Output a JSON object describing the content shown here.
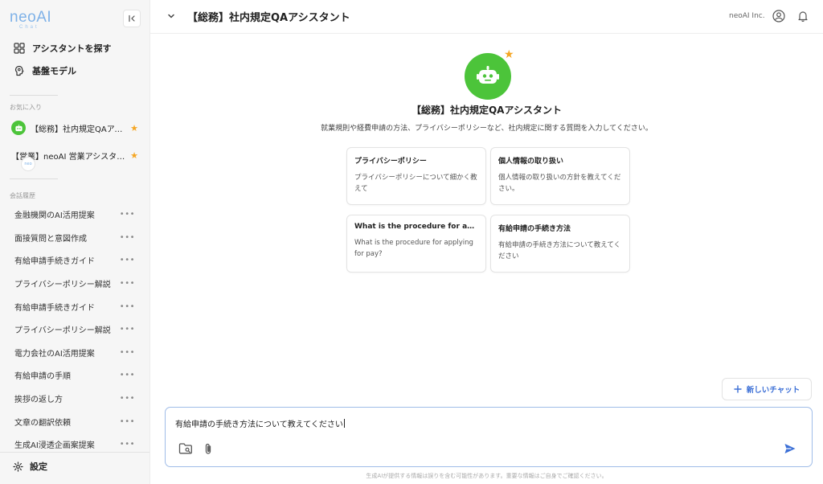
{
  "logo": {
    "main": "neoAI",
    "sub": "Chat"
  },
  "nav": {
    "find_assistant": "アシスタントを探す",
    "base_models": "基盤モデル"
  },
  "favorites": {
    "label": "お気に入り",
    "items": [
      {
        "label": "【総務】社内規定QAアシスタント",
        "avatar": "robot-icon"
      },
      {
        "label": "【営業】neoAI 営業アシスタント",
        "avatar": "neoai-logo-icon"
      }
    ]
  },
  "history": {
    "label": "会話履歴",
    "items": [
      "金融機関のAI活用提案",
      "面接質問と意図作成",
      "有給申請手続きガイド",
      "プライバシーポリシー解説",
      "有給申請手続きガイド",
      "プライバシーポリシー解説",
      "電力会社のAI活用提案",
      "有給申請の手順",
      "挨拶の返し方",
      "文章の翻訳依頼",
      "生成AI浸透企画案提案"
    ],
    "more": "•••"
  },
  "settings_label": "設定",
  "header": {
    "title": "【総務】社内規定QAアシスタント",
    "org": "neoAI Inc."
  },
  "assistant": {
    "title": "【総務】社内規定QAアシスタント",
    "description": "就業規則や経費申請の方法、プライバシーポリシーなど、社内規定に関する質問を入力してください。"
  },
  "suggestions": [
    {
      "title": "プライバシーポリシー",
      "body": "プライバシーポリシーについて細かく教えて"
    },
    {
      "title": "個人情報の取り扱い",
      "body": "個人情報の取り扱いの方針を教えてください。"
    },
    {
      "title": "What is the procedure for applying for pay?",
      "body": "What is the procedure for applying for pay?"
    },
    {
      "title": "有給申請の手続き方法",
      "body": "有給申請の手続き方法について教えてください"
    }
  ],
  "new_chat": "新しいチャット",
  "input": {
    "value": "有給申請の手続き方法について教えてください"
  },
  "disclaimer": "生成AIが提供する情報は誤りを含む可能性があります。重要な情報はご自身でご確認ください。",
  "colors": {
    "accent": "#3b6fd6",
    "assistant": "#4cc43a",
    "star": "#f5a623"
  }
}
